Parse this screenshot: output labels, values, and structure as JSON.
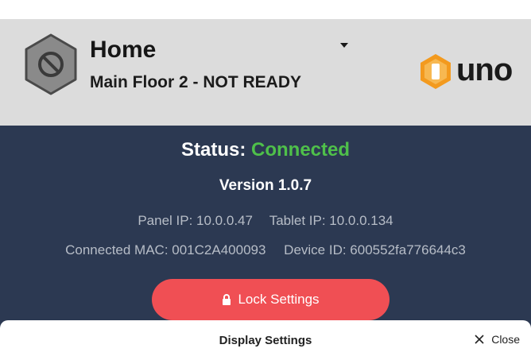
{
  "header": {
    "title": "Home",
    "subtitle": "Main Floor 2 - NOT READY",
    "logo_text": "uno"
  },
  "status": {
    "label": "Status:",
    "value": "Connected",
    "value_color": "#4fc04a"
  },
  "version": "Version 1.0.7",
  "network": {
    "panel_ip": "Panel IP: 10.0.0.47",
    "tablet_ip": "Tablet IP: 10.0.0.134",
    "connected_mac": "Connected MAC: 001C2A400093",
    "device_id": "Device ID: 600552fa776644c3"
  },
  "lock_button": {
    "label": "Lock Settings",
    "color": "#f04f54",
    "icon": "lock-icon"
  },
  "sheet": {
    "title": "Display Settings",
    "close_label": "Close",
    "close_icon": "close-icon"
  },
  "colors": {
    "header_bg": "#dcdcdc",
    "panel_bg": "#2c3952",
    "logo_orange": "#f39a1e"
  }
}
